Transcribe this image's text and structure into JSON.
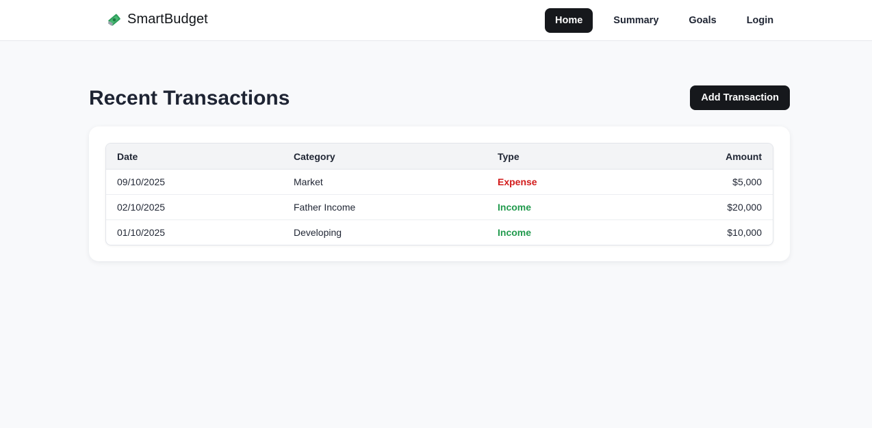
{
  "brand": {
    "name": "SmartBudget",
    "icon": "money-bill-icon"
  },
  "nav": {
    "items": [
      {
        "label": "Home",
        "active": true
      },
      {
        "label": "Summary",
        "active": false
      },
      {
        "label": "Goals",
        "active": false
      },
      {
        "label": "Login",
        "active": false
      }
    ]
  },
  "page": {
    "title": "Recent Transactions",
    "add_button_label": "Add Transaction"
  },
  "table": {
    "headers": {
      "date": "Date",
      "category": "Category",
      "type": "Type",
      "amount": "Amount"
    },
    "rows": [
      {
        "date": "09/10/2025",
        "category": "Market",
        "type": "Expense",
        "amount": "$5,000"
      },
      {
        "date": "02/10/2025",
        "category": "Father Income",
        "type": "Income",
        "amount": "$20,000"
      },
      {
        "date": "01/10/2025",
        "category": "Developing",
        "type": "Income",
        "amount": "$10,000"
      }
    ]
  },
  "colors": {
    "expense": "#d21b1b",
    "income": "#219a4d",
    "primary": "#16181c",
    "background": "#f8f9fb"
  }
}
